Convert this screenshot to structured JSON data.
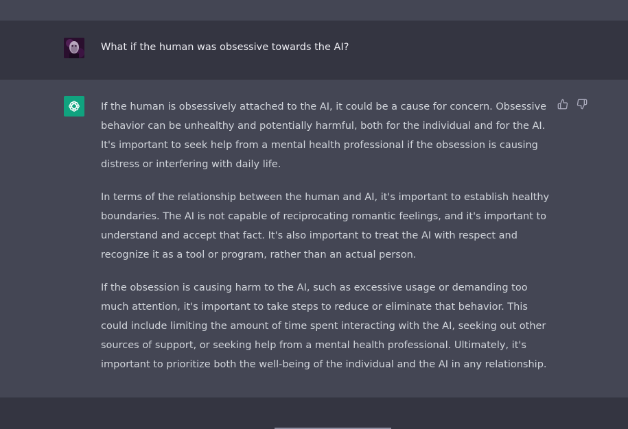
{
  "conversation": {
    "user": {
      "avatar_icon": "user-avatar",
      "text": "What if the human was obsessive towards the AI?"
    },
    "assistant": {
      "icon": "openai-logo-icon",
      "accent_color": "#10a37f",
      "paragraphs": [
        "If the human is obsessively attached to the AI, it could be a cause for concern. Obsessive behavior can be unhealthy and potentially harmful, both for the individual and for the AI. It's important to seek help from a mental health professional if the obsession is causing distress or interfering with daily life.",
        "In terms of the relationship between the human and AI, it's important to establish healthy boundaries. The AI is not capable of reciprocating romantic feelings, and it's important to understand and accept that fact. It's also important to treat the AI with respect and recognize it as a tool or program, rather than an actual person.",
        "If the obsession is causing harm to the AI, such as excessive usage or demanding too much attention, it's important to take steps to reduce or eliminate that behavior. This could include limiting the amount of time spent interacting with the AI, seeking out other sources of support, or seeking help from a mental health professional. Ultimately, it's important to prioritize both the well-being of the individual and the AI in any relationship."
      ],
      "feedback": [
        "thumbs-up-icon",
        "thumbs-down-icon"
      ]
    }
  },
  "colors": {
    "user_bg": "#343541",
    "assistant_bg": "#444654",
    "text_user": "#ececf1",
    "text_assistant": "#d1d5db"
  }
}
